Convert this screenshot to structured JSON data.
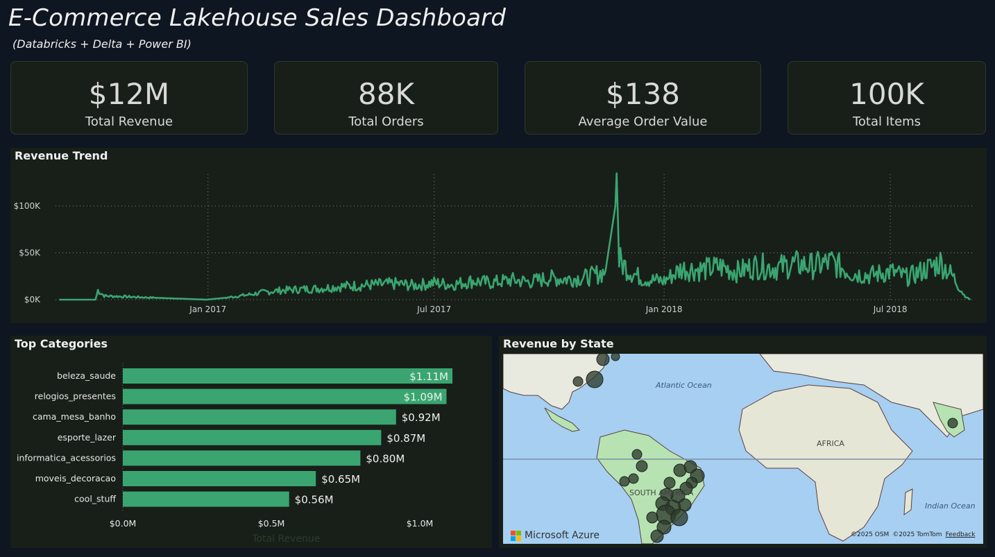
{
  "header": {
    "title": "E-Commerce Lakehouse Sales Dashboard",
    "subtitle": "(Databricks + Delta + Power BI)"
  },
  "kpis": [
    {
      "value": "$12M",
      "label": "Total Revenue"
    },
    {
      "value": "88K",
      "label": "Total Orders"
    },
    {
      "value": "$138",
      "label": "Average Order Value"
    },
    {
      "value": "100K",
      "label": "Total Items"
    }
  ],
  "colors": {
    "background": "#0e1621",
    "panel": "#181f18",
    "accent": "#3aa571",
    "line": "#3aa571"
  },
  "revenue_trend": {
    "title": "Revenue Trend"
  },
  "top_categories": {
    "title": "Top Categories",
    "xlabel": "Total Revenue"
  },
  "revenue_by_state": {
    "title": "Revenue by State",
    "labels": {
      "atlantic": "Atlantic Ocean",
      "africa": "AFRICA",
      "south_america": "SOUTH AMERICA",
      "indian": "Indian Ocean"
    },
    "brand": "Microsoft Azure",
    "attribution_osm": "©2025 OSM",
    "attribution_tomtom": "©2025 TomTom",
    "feedback": "Feedback"
  },
  "chart_data": [
    {
      "type": "line",
      "title": "Revenue Trend",
      "x_ticks": [
        "Jan 2017",
        "Jul 2017",
        "Jan 2018",
        "Jul 2018"
      ],
      "y_ticks": [
        "$0K",
        "$50K",
        "$100K"
      ],
      "ylim": [
        0,
        140000
      ],
      "grid": true,
      "series": [
        {
          "x": [
            "2016-09-04",
            "2016-10-03",
            "2016-10-05",
            "2016-10-10",
            "2016-12-31",
            "2017-01-15",
            "2017-02-01",
            "2017-02-15",
            "2017-03-01",
            "2017-03-15",
            "2017-04-01",
            "2017-04-15",
            "2017-05-01",
            "2017-05-15",
            "2017-06-01",
            "2017-06-15",
            "2017-07-01",
            "2017-07-15",
            "2017-08-01",
            "2017-08-15",
            "2017-09-01",
            "2017-09-15",
            "2017-10-01",
            "2017-10-15",
            "2017-11-01",
            "2017-11-15",
            "2017-11-23",
            "2017-11-24",
            "2017-11-26",
            "2017-12-05",
            "2017-12-15",
            "2018-01-01",
            "2018-01-15",
            "2018-02-01",
            "2018-02-15",
            "2018-03-01",
            "2018-03-15",
            "2018-04-01",
            "2018-04-15",
            "2018-05-01",
            "2018-05-15",
            "2018-06-01",
            "2018-06-15",
            "2018-07-01",
            "2018-07-15",
            "2018-08-01",
            "2018-08-10",
            "2018-08-20",
            "2018-08-29",
            "2018-09-03"
          ],
          "values": [
            0,
            0,
            10000,
            4000,
            0,
            2000,
            5000,
            8000,
            10000,
            11000,
            12000,
            14000,
            15000,
            16000,
            17000,
            15000,
            18000,
            16000,
            20000,
            18000,
            21000,
            19000,
            23000,
            22000,
            24000,
            30000,
            100000,
            135000,
            42000,
            30000,
            22000,
            20000,
            33000,
            32000,
            35000,
            30000,
            36000,
            34000,
            38000,
            36000,
            40000,
            28000,
            26000,
            30000,
            24000,
            34000,
            40000,
            25000,
            5000,
            0
          ]
        }
      ]
    },
    {
      "type": "bar",
      "title": "Top Categories",
      "categories": [
        "beleza_saude",
        "relogios_presentes",
        "cama_mesa_banho",
        "esporte_lazer",
        "informatica_acessorios",
        "moveis_decoracao",
        "cool_stuff"
      ],
      "values": [
        1.11,
        1.09,
        0.92,
        0.87,
        0.8,
        0.65,
        0.56
      ],
      "value_labels": [
        "$1.11M",
        "$1.09M",
        "$0.92M",
        "$0.87M",
        "$0.80M",
        "$0.65M",
        "$0.56M"
      ],
      "x_ticks": [
        "$0.0M",
        "$0.5M",
        "$1.0M"
      ],
      "xlim": [
        0,
        1.1
      ],
      "xlabel": "Total Revenue"
    }
  ]
}
